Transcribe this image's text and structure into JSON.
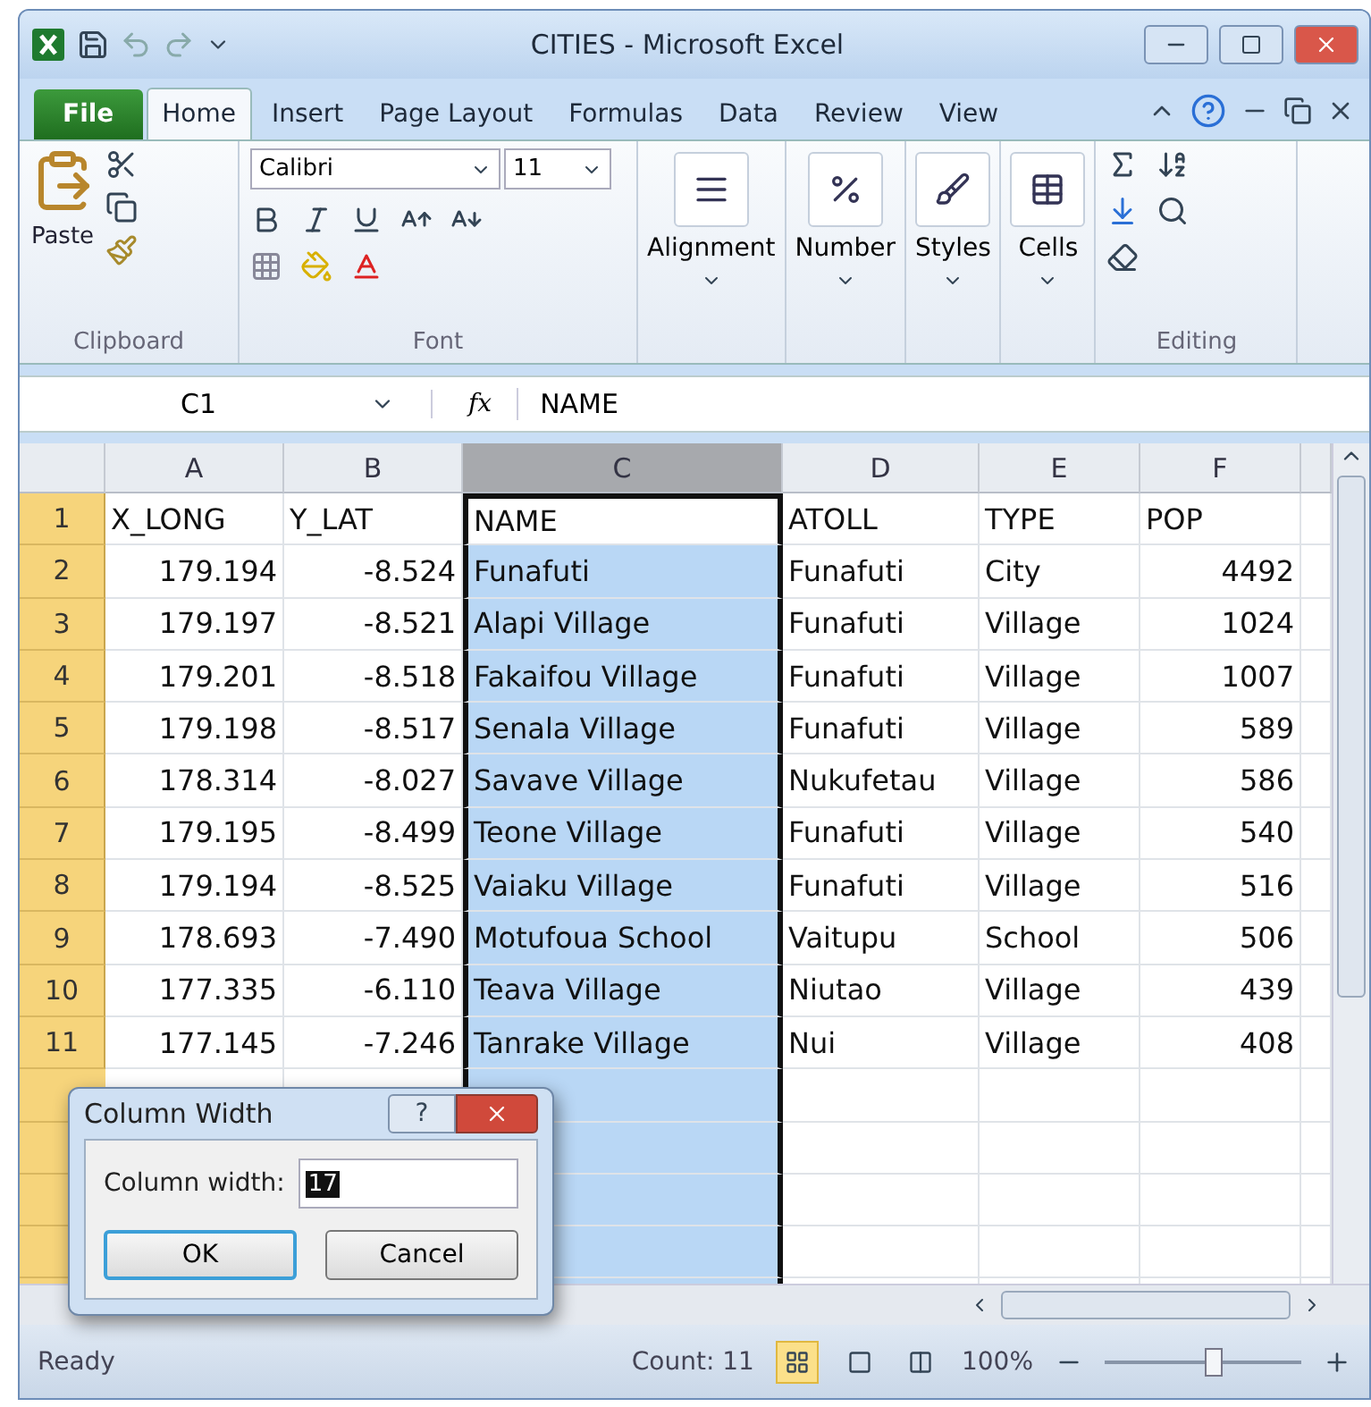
{
  "window": {
    "title": "CITIES  -  Microsoft Excel"
  },
  "tabs": [
    {
      "label": "File",
      "kind": "file",
      "selected": false
    },
    {
      "label": "Home",
      "kind": "tab",
      "selected": true
    },
    {
      "label": "Insert",
      "kind": "tab",
      "selected": false
    },
    {
      "label": "Page Layout",
      "kind": "tab",
      "selected": false
    },
    {
      "label": "Formulas",
      "kind": "tab",
      "selected": false
    },
    {
      "label": "Data",
      "kind": "tab",
      "selected": false
    },
    {
      "label": "Review",
      "kind": "tab",
      "selected": false
    },
    {
      "label": "View",
      "kind": "tab",
      "selected": false
    }
  ],
  "ribbon": {
    "paste_label": "Paste",
    "clipboard_group": "Clipboard",
    "font_name": "Calibri",
    "font_size": "11",
    "font_group": "Font",
    "big_buttons": [
      {
        "label": "Alignment",
        "kind": "alignment"
      },
      {
        "label": "Number",
        "kind": "number"
      },
      {
        "label": "Styles",
        "kind": "styles"
      },
      {
        "label": "Cells",
        "kind": "cells"
      }
    ],
    "editing_group": "Editing"
  },
  "formula_bar": {
    "name_box": "C1",
    "function_label": "fx",
    "value": "NAME"
  },
  "sheet": {
    "columns": [
      {
        "label": "A",
        "numeric": true,
        "selected": false
      },
      {
        "label": "B",
        "numeric": true,
        "selected": false
      },
      {
        "label": "C",
        "numeric": false,
        "selected": true
      },
      {
        "label": "D",
        "numeric": false,
        "selected": false
      },
      {
        "label": "E",
        "numeric": false,
        "selected": false
      },
      {
        "label": "F",
        "numeric": true,
        "selected": false
      }
    ],
    "rows": [
      {
        "number": "1",
        "header": true,
        "cells": [
          "X_LONG",
          "Y_LAT",
          "NAME",
          "ATOLL",
          "TYPE",
          "POP"
        ]
      },
      {
        "number": "2",
        "header": false,
        "cells": [
          "179.194",
          "-8.524",
          "Funafuti",
          "Funafuti",
          "City",
          "4492"
        ]
      },
      {
        "number": "3",
        "header": false,
        "cells": [
          "179.197",
          "-8.521",
          "Alapi Village",
          "Funafuti",
          "Village",
          "1024"
        ]
      },
      {
        "number": "4",
        "header": false,
        "cells": [
          "179.201",
          "-8.518",
          "Fakaifou Village",
          "Funafuti",
          "Village",
          "1007"
        ]
      },
      {
        "number": "5",
        "header": false,
        "cells": [
          "179.198",
          "-8.517",
          "Senala Village",
          "Funafuti",
          "Village",
          "589"
        ]
      },
      {
        "number": "6",
        "header": false,
        "cells": [
          "178.314",
          "-8.027",
          "Savave Village",
          "Nukufetau",
          "Village",
          "586"
        ]
      },
      {
        "number": "7",
        "header": false,
        "cells": [
          "179.195",
          "-8.499",
          "Teone Village",
          "Funafuti",
          "Village",
          "540"
        ]
      },
      {
        "number": "8",
        "header": false,
        "cells": [
          "179.194",
          "-8.525",
          "Vaiaku Village",
          "Funafuti",
          "Village",
          "516"
        ]
      },
      {
        "number": "9",
        "header": false,
        "cells": [
          "178.693",
          "-7.490",
          "Motufoua School",
          "Vaitupu",
          "School",
          "506"
        ]
      },
      {
        "number": "10",
        "header": false,
        "cells": [
          "177.335",
          "-6.110",
          "Teava Village",
          "Niutao",
          "Village",
          "439"
        ]
      },
      {
        "number": "11",
        "header": false,
        "cells": [
          "177.145",
          "-7.246",
          "Tanrake Village",
          "Nui",
          "Village",
          "408"
        ]
      }
    ]
  },
  "status_bar": {
    "mode": "Ready",
    "count": "Count: 11",
    "zoom": "100%",
    "level": 0.55
  },
  "dialog": {
    "title": "Column Width",
    "help": "?",
    "field_label": "Column width:",
    "field_value": "17",
    "buttons": [
      {
        "label": "OK",
        "default": true
      },
      {
        "label": "Cancel",
        "default": false
      }
    ]
  }
}
